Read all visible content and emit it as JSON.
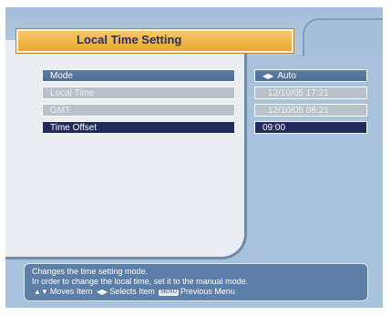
{
  "title": "Local Time Setting",
  "rows": [
    {
      "label": "Mode",
      "value": "Auto",
      "state": "highlighted",
      "icon": "left-right-arrows-icon"
    },
    {
      "label": "Local Time",
      "value": "12/10/05 17:21",
      "state": "disabled"
    },
    {
      "label": "GMT",
      "value": "12/10/05 08:21",
      "state": "disabled"
    },
    {
      "label": "Time Offset",
      "value": "09:00",
      "state": "selected"
    }
  ],
  "help": {
    "line1": "Changes the time setting mode.",
    "line2": "In order to change the local time, set it to the manual mode.",
    "moves": "Moves Item",
    "selects": "Selects Item",
    "menu_key": "MENU",
    "previous": "Previous Menu"
  },
  "colors": {
    "title_bar": "#e8a930",
    "row_blue": "#4b6b94",
    "row_grey": "#b9c1cb",
    "row_selected": "#22295e",
    "background": "#a9c2db"
  }
}
